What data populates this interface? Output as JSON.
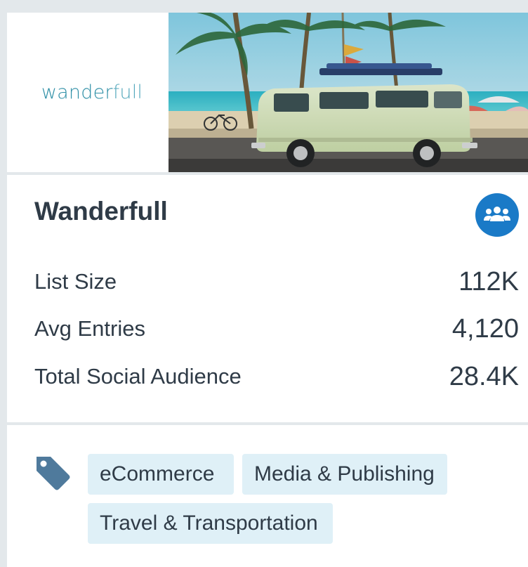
{
  "brand": {
    "logo_text_main": "wander",
    "logo_text_thin": "full",
    "name": "Wanderfull"
  },
  "stats": [
    {
      "label": "List Size",
      "value": "112K"
    },
    {
      "label": "Avg Entries",
      "value": "4,120"
    },
    {
      "label": "Total Social Audience",
      "value": "28.4K"
    }
  ],
  "tags": [
    "eCommerce",
    "Media & Publishing",
    "Travel & Transportation"
  ],
  "icons": {
    "audience": "users-group-icon",
    "tag": "tag-icon"
  },
  "colors": {
    "accent": "#1a7ac7",
    "chip_bg": "#dff0f7",
    "text": "#2f3b47",
    "logo": "#2e8fa6"
  }
}
